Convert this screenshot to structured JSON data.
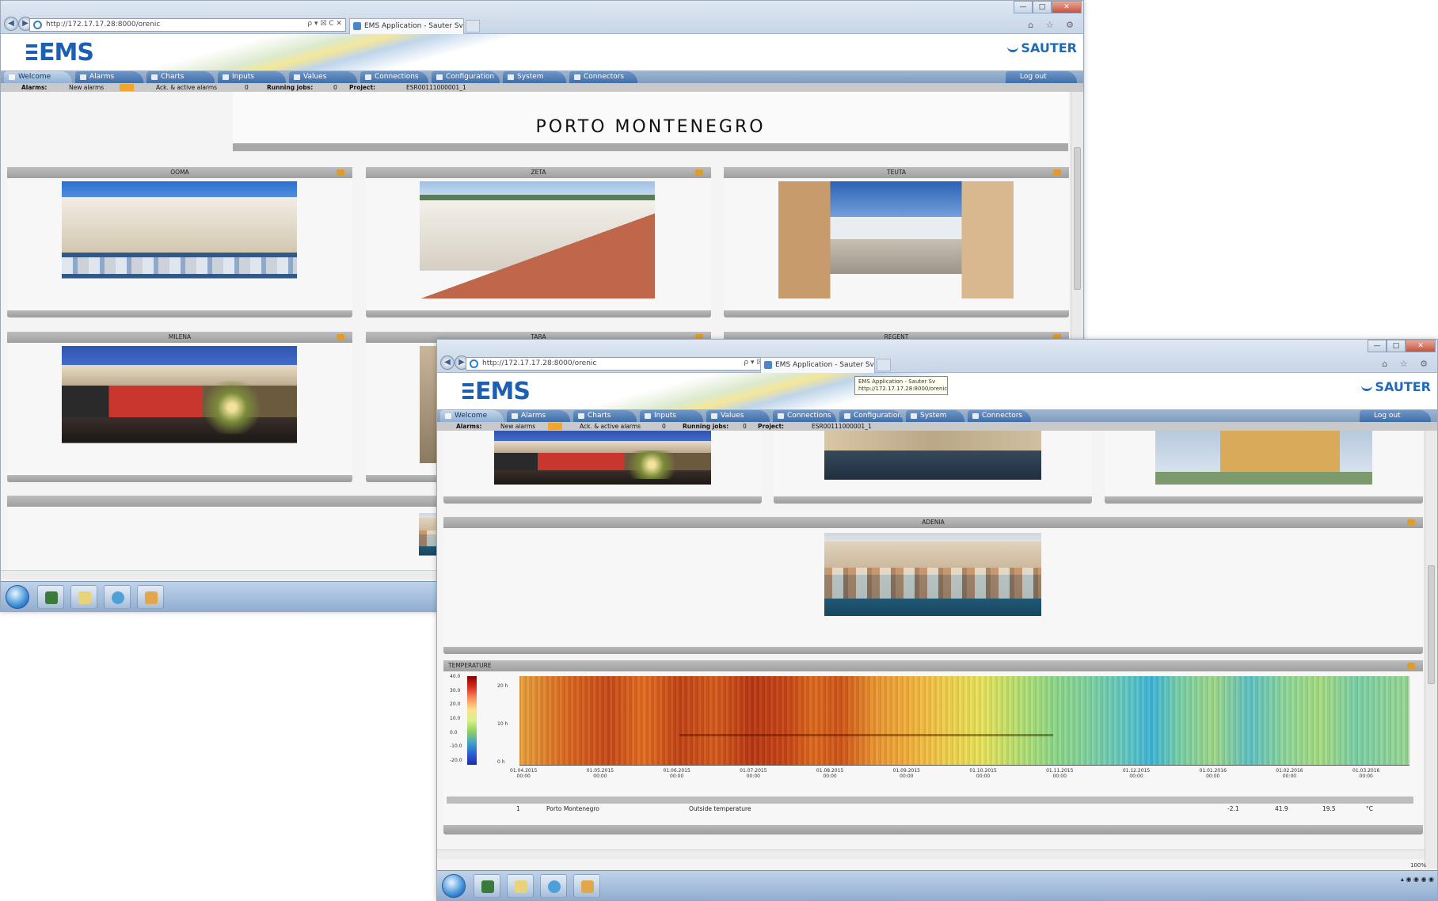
{
  "browser": {
    "url": "http://172.17.17.28:8000/orenic",
    "tab_title": "EMS Application - Sauter Sv...",
    "tooltip_title": "EMS Application - Sauter Sv",
    "tooltip_url": "http://172.17.17.28:8000/orenic",
    "nav_back": "◀",
    "nav_forward": "▶",
    "url_controls": "ρ ▾ ☒ C ✕",
    "win_min": "—",
    "win_max": "□",
    "win_close": "✕",
    "toolbar_icons": "⌂ ☆ ⚙"
  },
  "app": {
    "logo": "EMS",
    "brand": "SAUTER",
    "menu": [
      {
        "label": "Welcome"
      },
      {
        "label": "Alarms"
      },
      {
        "label": "Charts"
      },
      {
        "label": "Inputs"
      },
      {
        "label": "Values"
      },
      {
        "label": "Connections"
      },
      {
        "label": "Configuration"
      },
      {
        "label": "System"
      },
      {
        "label": "Connectors"
      }
    ],
    "logout": "Log out"
  },
  "status": {
    "alarms_label": "Alarms:",
    "new_alarms_label": "New alarms",
    "ack_active_label": "Ack. & active alarms",
    "ack_active_count": "0",
    "running_jobs_label": "Running jobs:",
    "running_jobs_count": "0",
    "project_label": "Project:",
    "project_id": "ESR00111000001_1"
  },
  "window1": {
    "title": "PORTO MONTENEGRO",
    "panels": [
      {
        "name": "OOMA"
      },
      {
        "name": "ZETA"
      },
      {
        "name": "TEUTA"
      },
      {
        "name": "MILENA"
      },
      {
        "name": "TARA"
      },
      {
        "name": "REGENT"
      }
    ]
  },
  "window2": {
    "panels": [
      {
        "name": "ADENIA"
      },
      {
        "name": "TEMPERATURE"
      }
    ],
    "zoom": "100%"
  },
  "chart_data": {
    "type": "heatmap",
    "title": "TEMPERATURE",
    "colorbar_ticks": [
      "40.0",
      "30.0",
      "20.0",
      "10.0",
      "0.0",
      "-10.0",
      "-20.0"
    ],
    "y_ticks": [
      "20 h",
      "10 h",
      "0 h"
    ],
    "x_ticks": [
      {
        "date": "01.04.2015",
        "time": "00:00"
      },
      {
        "date": "01.05.2015",
        "time": "00:00"
      },
      {
        "date": "01.06.2015",
        "time": "00:00"
      },
      {
        "date": "01.07.2015",
        "time": "00:00"
      },
      {
        "date": "01.08.2015",
        "time": "00:00"
      },
      {
        "date": "01.09.2015",
        "time": "00:00"
      },
      {
        "date": "01.10.2015",
        "time": "00:00"
      },
      {
        "date": "01.11.2015",
        "time": "00:00"
      },
      {
        "date": "01.12.2015",
        "time": "00:00"
      },
      {
        "date": "01.01.2016",
        "time": "00:00"
      },
      {
        "date": "01.02.2016",
        "time": "00:00"
      },
      {
        "date": "01.03.2016",
        "time": "00:00"
      }
    ],
    "legend_row": {
      "index": "1",
      "site": "Porto Montenegro",
      "measure": "Outside temperature",
      "min": "-2.1",
      "max": "41.9",
      "avg": "19.5",
      "unit": "°C"
    }
  },
  "colors": {
    "accent": "#1d5fb0",
    "menu": "#3f6ea8",
    "panel_header": "#a8a8a8",
    "alarm_indicator": "#f2a72a"
  },
  "icons": [
    "ie-icon",
    "back-icon",
    "forward-icon",
    "lock-icon",
    "start-orb-icon",
    "explorer-icon",
    "media-icon",
    "folder-icon",
    "ie-taskbar-icon"
  ]
}
